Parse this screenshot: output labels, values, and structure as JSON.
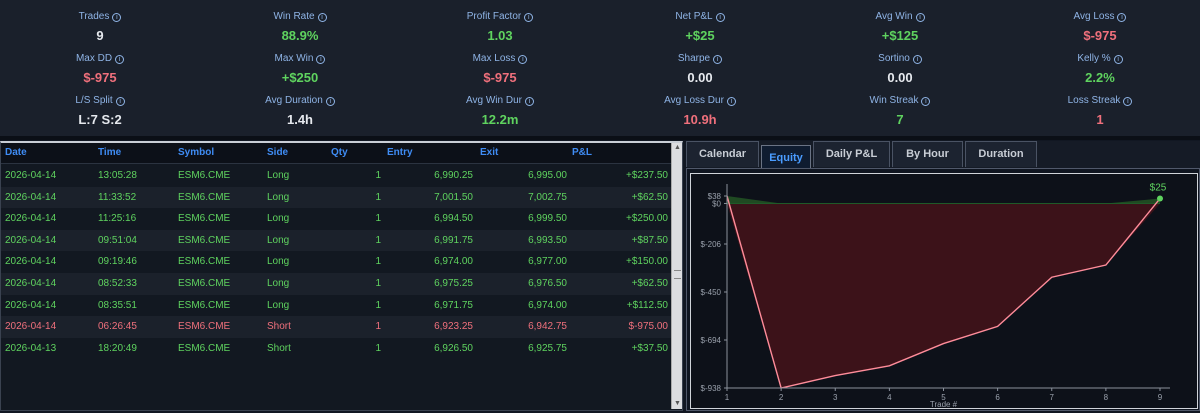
{
  "stats": [
    {
      "label": "Trades",
      "value": "9",
      "color": "white"
    },
    {
      "label": "Win Rate",
      "value": "88.9%",
      "color": "green"
    },
    {
      "label": "Profit Factor",
      "value": "1.03",
      "color": "green"
    },
    {
      "label": "Net P&L",
      "value": "+$25",
      "color": "green"
    },
    {
      "label": "Avg Win",
      "value": "+$125",
      "color": "green"
    },
    {
      "label": "Avg Loss",
      "value": "$-975",
      "color": "red"
    },
    {
      "label": "Max DD",
      "value": "$-975",
      "color": "red"
    },
    {
      "label": "Max Win",
      "value": "+$250",
      "color": "green"
    },
    {
      "label": "Max Loss",
      "value": "$-975",
      "color": "red"
    },
    {
      "label": "Sharpe",
      "value": "0.00",
      "color": "white"
    },
    {
      "label": "Sortino",
      "value": "0.00",
      "color": "white"
    },
    {
      "label": "Kelly %",
      "value": "2.2%",
      "color": "green"
    },
    {
      "label": "L/S Split",
      "value": "L:7 S:2",
      "color": "white"
    },
    {
      "label": "Avg Duration",
      "value": "1.4h",
      "color": "white"
    },
    {
      "label": "Avg Win Dur",
      "value": "12.2m",
      "color": "green"
    },
    {
      "label": "Avg Loss Dur",
      "value": "10.9h",
      "color": "red"
    },
    {
      "label": "Win Streak",
      "value": "7",
      "color": "green"
    },
    {
      "label": "Loss Streak",
      "value": "1",
      "color": "red"
    }
  ],
  "info_glyph": "i",
  "table": {
    "columns": [
      "Date",
      "Time",
      "Symbol",
      "Side",
      "Qty",
      "Entry",
      "Exit",
      "P&L"
    ],
    "rows": [
      {
        "date": "2026-04-14",
        "time": "13:05:28",
        "symbol": "ESM6.CME",
        "side": "Long",
        "qty": "1",
        "entry": "6,990.25",
        "exit": "6,995.00",
        "pnl": "+$237.50",
        "outcome": "win"
      },
      {
        "date": "2026-04-14",
        "time": "11:33:52",
        "symbol": "ESM6.CME",
        "side": "Long",
        "qty": "1",
        "entry": "7,001.50",
        "exit": "7,002.75",
        "pnl": "+$62.50",
        "outcome": "win"
      },
      {
        "date": "2026-04-14",
        "time": "11:25:16",
        "symbol": "ESM6.CME",
        "side": "Long",
        "qty": "1",
        "entry": "6,994.50",
        "exit": "6,999.50",
        "pnl": "+$250.00",
        "outcome": "win"
      },
      {
        "date": "2026-04-14",
        "time": "09:51:04",
        "symbol": "ESM6.CME",
        "side": "Long",
        "qty": "1",
        "entry": "6,991.75",
        "exit": "6,993.50",
        "pnl": "+$87.50",
        "outcome": "win"
      },
      {
        "date": "2026-04-14",
        "time": "09:19:46",
        "symbol": "ESM6.CME",
        "side": "Long",
        "qty": "1",
        "entry": "6,974.00",
        "exit": "6,977.00",
        "pnl": "+$150.00",
        "outcome": "win"
      },
      {
        "date": "2026-04-14",
        "time": "08:52:33",
        "symbol": "ESM6.CME",
        "side": "Long",
        "qty": "1",
        "entry": "6,975.25",
        "exit": "6,976.50",
        "pnl": "+$62.50",
        "outcome": "win"
      },
      {
        "date": "2026-04-14",
        "time": "08:35:51",
        "symbol": "ESM6.CME",
        "side": "Long",
        "qty": "1",
        "entry": "6,971.75",
        "exit": "6,974.00",
        "pnl": "+$112.50",
        "outcome": "win"
      },
      {
        "date": "2026-04-14",
        "time": "06:26:45",
        "symbol": "ESM6.CME",
        "side": "Short",
        "qty": "1",
        "entry": "6,923.25",
        "exit": "6,942.75",
        "pnl": "$-975.00",
        "outcome": "loss"
      },
      {
        "date": "2026-04-13",
        "time": "18:20:49",
        "symbol": "ESM6.CME",
        "side": "Short",
        "qty": "1",
        "entry": "6,926.50",
        "exit": "6,925.75",
        "pnl": "+$37.50",
        "outcome": "win"
      }
    ]
  },
  "scrollbar": {
    "up_glyph": "▲",
    "down_glyph": "▼"
  },
  "tabs": [
    {
      "label": "Calendar",
      "active": false
    },
    {
      "label": "Equity",
      "active": true
    },
    {
      "label": "Daily P&L",
      "active": false
    },
    {
      "label": "By Hour",
      "active": false
    },
    {
      "label": "Duration",
      "active": false
    }
  ],
  "colors": {
    "win": "#5fd35f",
    "loss": "#f0707c",
    "accent": "#3f8cf4",
    "equity_line": "#ff8c9a",
    "drawdown_fill": "#3c1219",
    "positive_fill": "#1f4a22"
  },
  "chart_data": {
    "type": "area",
    "x": [
      1,
      2,
      3,
      4,
      5,
      6,
      7,
      8,
      9
    ],
    "y": [
      38,
      -938,
      -875,
      -825,
      -712,
      -625,
      -375,
      -313,
      25
    ],
    "xlabel": "Trade #",
    "ylabel": "",
    "yticks": [
      38,
      0,
      -206,
      -450,
      -694,
      -938
    ],
    "ytick_labels": [
      "$38",
      "$0",
      "$-206",
      "$-450",
      "$-694",
      "$-938"
    ],
    "xticks": [
      "1",
      "2",
      "3",
      "4",
      "5",
      "6",
      "7",
      "8",
      "9"
    ],
    "ylim": [
      -938,
      38
    ],
    "end_label": "$25",
    "grid": false
  }
}
